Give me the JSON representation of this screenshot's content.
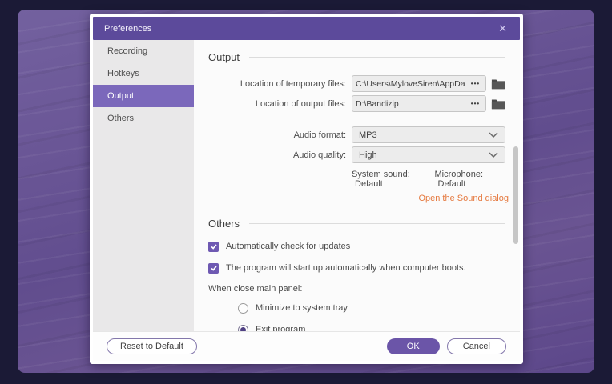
{
  "window": {
    "title": "Preferences",
    "close_glyph": "✕"
  },
  "sidebar": {
    "items": [
      {
        "label": "Recording",
        "selected": false
      },
      {
        "label": "Hotkeys",
        "selected": false
      },
      {
        "label": "Output",
        "selected": true
      },
      {
        "label": "Others",
        "selected": false
      }
    ]
  },
  "output_section": {
    "title": "Output",
    "fields": [
      {
        "label": "Location of temporary files:",
        "value": "C:\\Users\\MyloveSiren\\AppData\\Loc",
        "browse_icon": "•••"
      },
      {
        "label": "Location of output files:",
        "value": "D:\\Bandizip",
        "browse_icon": "•••"
      }
    ],
    "dropdowns": [
      {
        "label": "Audio format:",
        "value": "MP3"
      },
      {
        "label": "Audio quality:",
        "value": "High"
      }
    ],
    "sound_status": {
      "system_label": "System sound:",
      "system_value": "Default",
      "mic_label": "Microphone:",
      "mic_value": "Default"
    },
    "sound_link": "Open the Sound dialog"
  },
  "others_section": {
    "title": "Others",
    "checkboxes": [
      {
        "label": "Automatically check for updates",
        "checked": true
      },
      {
        "label": "The program will start up automatically when computer boots.",
        "checked": true
      }
    ],
    "close_panel": {
      "label": "When close main panel:",
      "options": [
        {
          "label": "Minimize to system tray",
          "selected": false
        },
        {
          "label": "Exit program",
          "selected": true
        }
      ]
    }
  },
  "footer": {
    "reset_label": "Reset to Default",
    "ok_label": "OK",
    "cancel_label": "Cancel"
  },
  "colors": {
    "titlebar": "#5c4a9b",
    "sidebar_selected": "#7b68bb",
    "accent_purple": "#6b55a8",
    "checkbox": "#6e59b2",
    "link_orange": "#e5793f",
    "outer_frame": "#1b1a36",
    "wallpaper": "#65528f"
  }
}
